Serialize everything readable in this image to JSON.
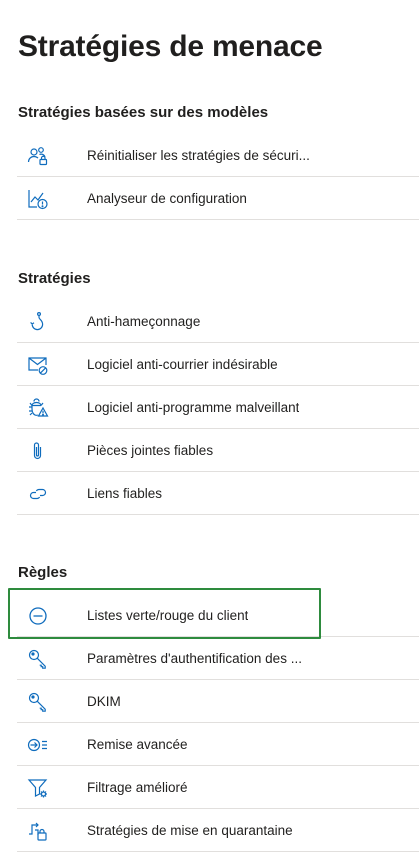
{
  "page": {
    "title": "Stratégies de menace"
  },
  "sections": {
    "templates": {
      "header": "Stratégies basées sur des modèles",
      "items": [
        {
          "label": "Réinitialiser les stratégies de sécuri...",
          "icon": "people-lock-icon"
        },
        {
          "label": "Analyseur de configuration",
          "icon": "chart-warning-icon"
        }
      ]
    },
    "policies": {
      "header": "Stratégies",
      "items": [
        {
          "label": "Anti-hameçonnage",
          "icon": "hook-icon"
        },
        {
          "label": "Logiciel anti-courrier indésirable",
          "icon": "mail-block-icon"
        },
        {
          "label": "Logiciel anti-programme malveillant",
          "icon": "bug-warning-icon"
        },
        {
          "label": "Pièces jointes fiables",
          "icon": "paperclip-icon"
        },
        {
          "label": "Liens fiables",
          "icon": "link-icon"
        }
      ]
    },
    "rules": {
      "header": "Règles",
      "items": [
        {
          "label": "Listes verte/rouge du client",
          "icon": "minus-circle-icon"
        },
        {
          "label": "Paramètres d'authentification des ...",
          "icon": "key-icon"
        },
        {
          "label": "DKIM",
          "icon": "key-icon"
        },
        {
          "label": "Remise avancée",
          "icon": "delivery-icon"
        },
        {
          "label": "Filtrage amélioré",
          "icon": "filter-settings-icon"
        },
        {
          "label": "Stratégies de mise en quarantaine",
          "icon": "quarantine-icon"
        }
      ]
    }
  },
  "colors": {
    "icon": "#0f6cbd",
    "highlight": "#2e8b3e",
    "divider": "#e1dfdd"
  }
}
